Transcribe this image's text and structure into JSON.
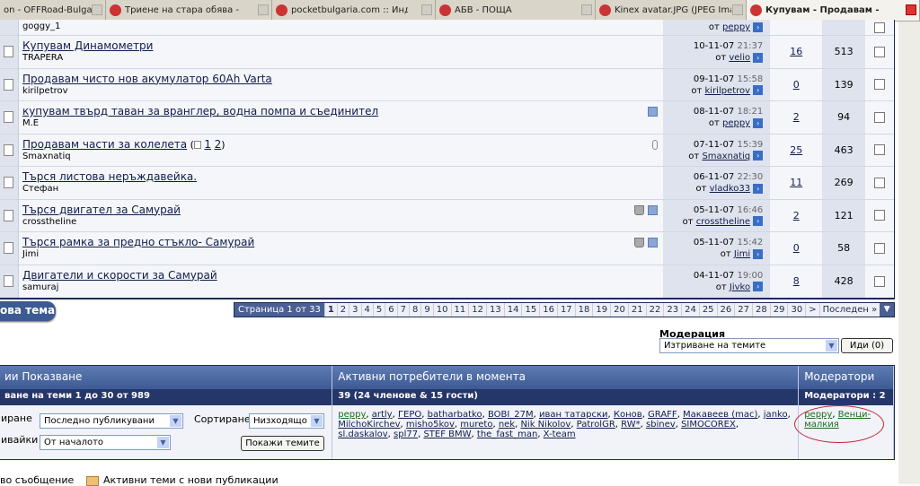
{
  "browser_tabs": [
    {
      "title": "on - OFFRoad-Bulgari...",
      "active": false
    },
    {
      "title": "Триене на стара обява - OF...",
      "active": false
    },
    {
      "title": "pocketbulgaria.com :: Индекс",
      "active": false
    },
    {
      "title": "АБВ - ПОЩА",
      "active": false
    },
    {
      "title": "Kinex avatar.JPG (JPEG Imag...",
      "active": false
    },
    {
      "title": "Купувам - Продавам - О...",
      "active": true
    }
  ],
  "by_label": "от",
  "threads": [
    {
      "title": "",
      "author": "goggy_1",
      "date": "",
      "time": "",
      "last_by": "peppy",
      "replies": "",
      "views": "",
      "flags": []
    },
    {
      "title": "Купувам Динамометри",
      "author": "TRAPERA",
      "date": "10-11-07",
      "time": "21:37",
      "last_by": "velio",
      "replies": "16",
      "views": "513",
      "flags": []
    },
    {
      "title": "Продавам чисто нов акумулатор 60Ah Varta",
      "author": "kirilpetrov",
      "date": "09-11-07",
      "time": "15:58",
      "last_by": "kirilpetrov",
      "replies": "0",
      "views": "139",
      "flags": []
    },
    {
      "title": "купувам твърд таван за вранглер, водна помпа и съединител",
      "author": "M.E",
      "date": "08-11-07",
      "time": "18:21",
      "last_by": "peppy",
      "replies": "2",
      "views": "94",
      "flags": [
        "check"
      ]
    },
    {
      "title": "Продавам части за колелета",
      "pages": [
        "1",
        "2"
      ],
      "author": "Smaxnatiq",
      "date": "07-11-07",
      "time": "15:39",
      "last_by": "Smaxnatiq",
      "replies": "25",
      "views": "463",
      "flags": [
        "clip"
      ]
    },
    {
      "title": "Търся листова неръждавейка.",
      "author": "Стефан",
      "date": "06-11-07",
      "time": "22:30",
      "last_by": "vladko33",
      "replies": "11",
      "views": "269",
      "flags": []
    },
    {
      "title": "Търся двигател за Самурай",
      "author": "crosstheline",
      "date": "05-11-07",
      "time": "16:46",
      "last_by": "crosstheline",
      "replies": "2",
      "views": "121",
      "flags": [
        "trash",
        "check"
      ]
    },
    {
      "title": "Търся рамка за предно стъкло- Самурай",
      "author": "Jimi",
      "date": "05-11-07",
      "time": "15:42",
      "last_by": "Jimi",
      "replies": "0",
      "views": "58",
      "flags": [
        "trash",
        "check"
      ]
    },
    {
      "title": "Двигатели и скорости за Самурай",
      "author": "samuraj",
      "date": "04-11-07",
      "time": "19:00",
      "last_by": "Jivko",
      "replies": "8",
      "views": "428",
      "flags": []
    }
  ],
  "new_topic_label": "ова тема",
  "pager": {
    "label": "Страница 1 от 33",
    "current": "1",
    "pages": [
      "1",
      "2",
      "3",
      "4",
      "5",
      "6",
      "7",
      "8",
      "9",
      "10",
      "11",
      "12",
      "13",
      "14",
      "15",
      "16",
      "17",
      "18",
      "19",
      "20",
      "21",
      "22",
      "23",
      "24",
      "25",
      "26",
      "27",
      "28",
      "29",
      "30"
    ],
    "next": ">",
    "last": "Последен »"
  },
  "moderation": {
    "label": "Модерация",
    "selected": "Изтриване на темите",
    "go": "Иди (0)"
  },
  "info": {
    "display_header": "ии Показване",
    "display_sub": "ване на теми 1 до 30 от 989",
    "sort_label": "иране",
    "sort_value": "Последно публикувани",
    "order_label": "Сортиране",
    "order_value": "Низходящо",
    "from_label": "ивайки",
    "from_value": "От началото",
    "show_button": "Покажи темите",
    "active_header": "Активни потребители в момента",
    "active_sub": "39 (24 членове & 15 гости)",
    "users": [
      "peppy",
      "artly",
      "ГЕРО",
      "batharbatko",
      "BOBI_27M",
      "иван татарски",
      "Конов",
      "GRAFF",
      "Макавеев (mac)",
      "janko",
      "MilchoKirchev",
      "misho5kov",
      "mureto",
      "nek",
      "Nik Nikolov",
      "PatrolGR",
      "RW*",
      "sbinev",
      "SIMOCOREX",
      "sl.daskalov",
      "spl77",
      "STEF BMW",
      "the_fast_man",
      "X-team"
    ],
    "mods_header": "Модератори",
    "mods_sub": "Модератори : 2",
    "mods": [
      "peppy",
      "Венци-малкия"
    ]
  },
  "legend": {
    "new_post": "во съобщение",
    "active_new": "Активни теми с нови публикации"
  },
  "colors": {
    "header": "#3d5a94",
    "subheader": "#25366b",
    "row_light": "#f5f6fa",
    "row_dark": "#dfe3ee",
    "annotation": "#c2263a"
  }
}
